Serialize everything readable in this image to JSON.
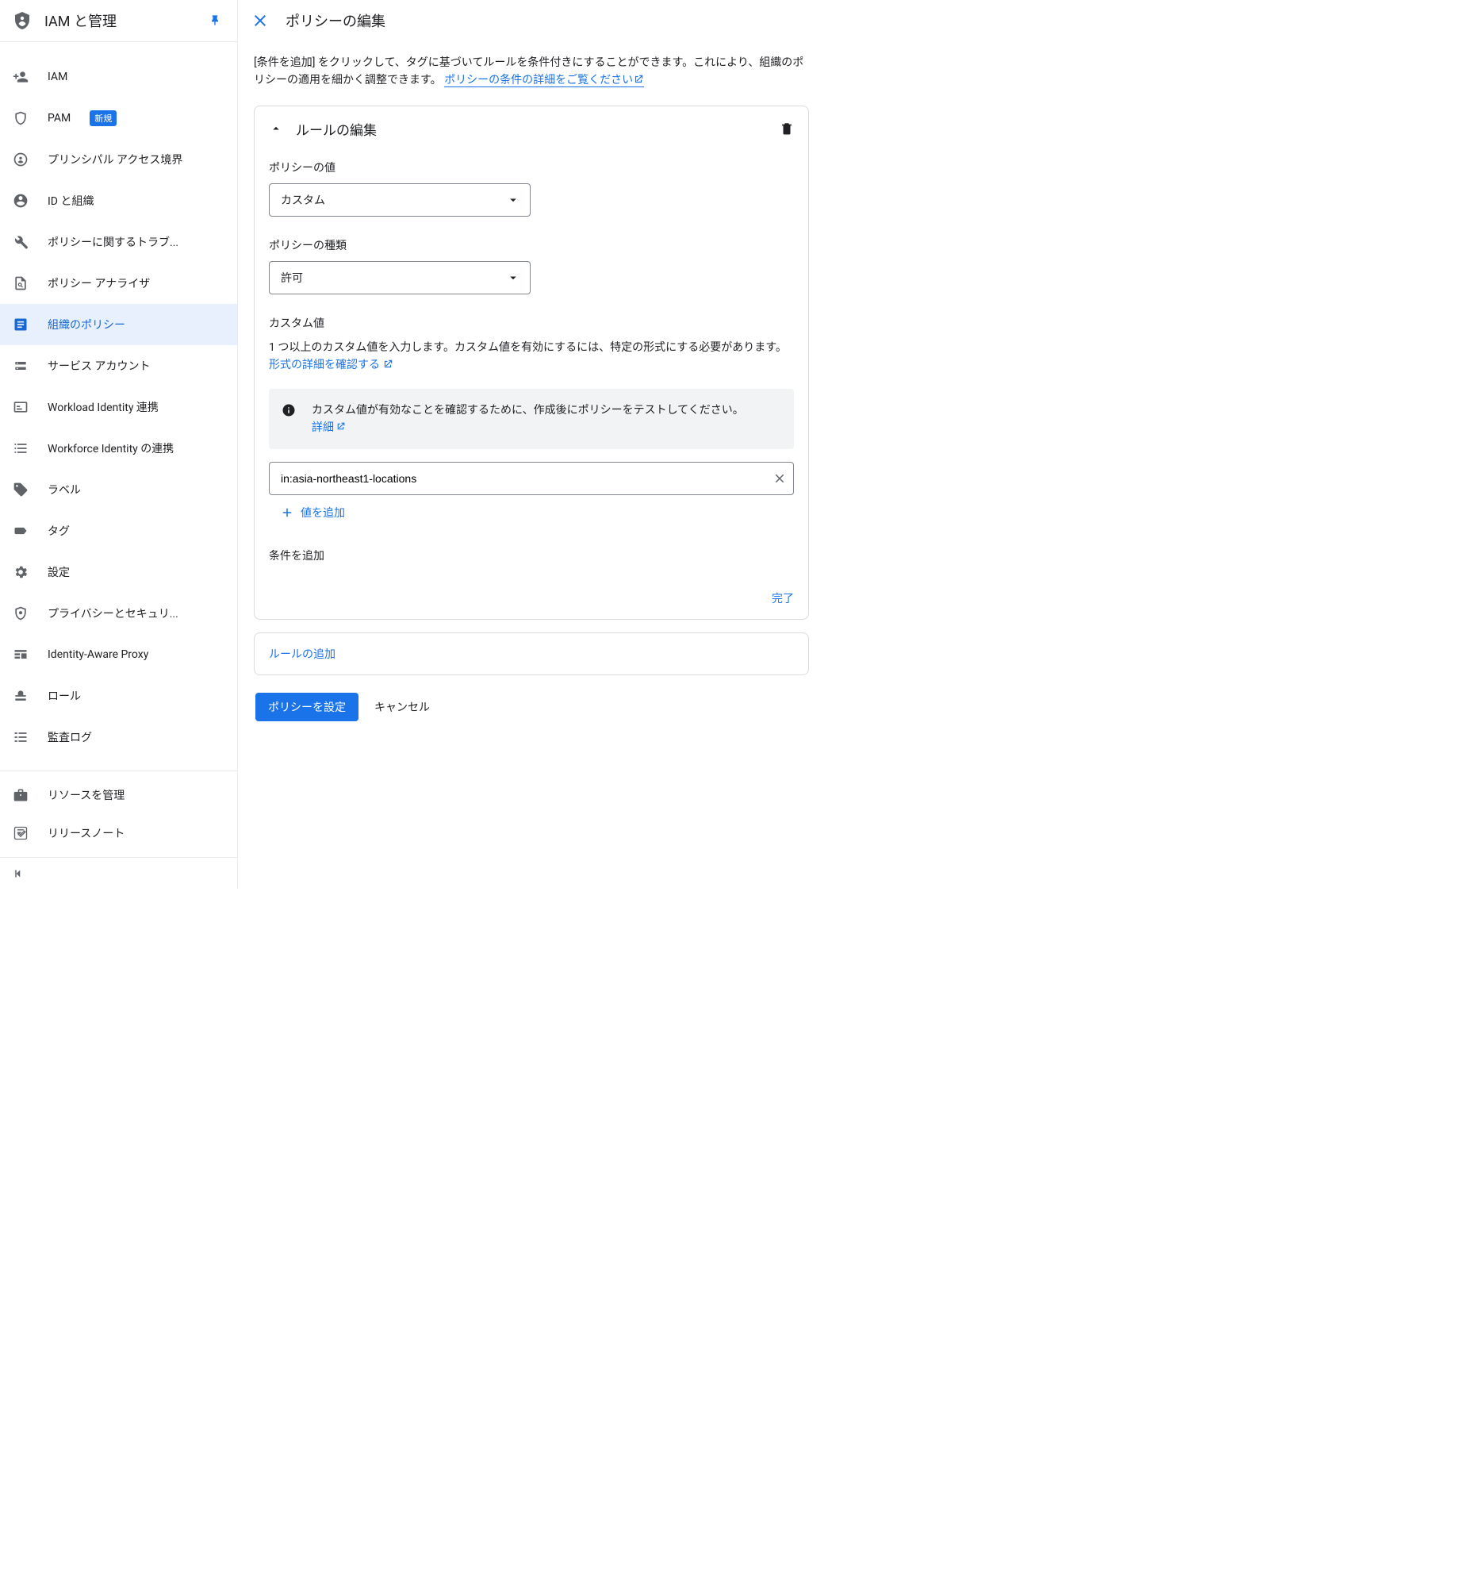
{
  "sidebar": {
    "title": "IAM と管理",
    "items": [
      {
        "label": "IAM"
      },
      {
        "label": "PAM",
        "badge": "新規"
      },
      {
        "label": "プリンシパル アクセス境界"
      },
      {
        "label": "ID と組織"
      },
      {
        "label": "ポリシーに関するトラブ..."
      },
      {
        "label": "ポリシー アナライザ"
      },
      {
        "label": "組織のポリシー"
      },
      {
        "label": "サービス アカウント"
      },
      {
        "label": "Workload Identity 連携"
      },
      {
        "label": "Workforce Identity の連携"
      },
      {
        "label": "ラベル"
      },
      {
        "label": "タグ"
      },
      {
        "label": "設定"
      },
      {
        "label": "プライバシーとセキュリ..."
      },
      {
        "label": "Identity-Aware Proxy"
      },
      {
        "label": "ロール"
      },
      {
        "label": "監査ログ"
      }
    ],
    "footer": [
      {
        "label": "リソースを管理"
      },
      {
        "label": "リリースノート"
      }
    ]
  },
  "main": {
    "title": "ポリシーの編集",
    "intro_prefix": "[条件を追加] をクリックして、タグに基づいてルールを条件付きにすることができます。これにより、組織のポリシーの適用を細かく調整できます。",
    "intro_link": "ポリシーの条件の詳細をご覧ください",
    "card": {
      "title": "ルールの編集",
      "policy_value_label": "ポリシーの値",
      "policy_value_selected": "カスタム",
      "policy_type_label": "ポリシーの種類",
      "policy_type_selected": "許可",
      "custom_value_label": "カスタム値",
      "custom_value_desc_prefix": "1 つ以上のカスタム値を入力します。カスタム値を有効にするには、特定の形式にする必要があります。",
      "custom_value_desc_link": "形式の詳細を確認する",
      "notice_text": "カスタム値が有効なことを確認するために、作成後にポリシーをテストしてください。",
      "notice_link": "詳細",
      "value_input": "in:asia-northeast1-locations",
      "add_value": "値を追加",
      "condition_label": "条件を追加",
      "done": "完了"
    },
    "add_rule": "ルールの追加",
    "set_policy": "ポリシーを設定",
    "cancel": "キャンセル"
  }
}
